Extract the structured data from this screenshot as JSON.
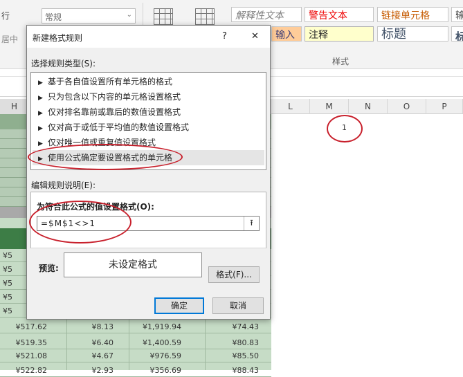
{
  "ribbon": {
    "left_label_1": "行",
    "left_label_2": "居中",
    "number_format": "常规",
    "styles": {
      "explanatory": "解释性文本",
      "warning": "警告文本",
      "linked_cell": "链接单元格",
      "input": "输入",
      "note": "注释",
      "title": "标题",
      "heading_partial_1": "输",
      "heading_partial_2": "标"
    },
    "group_label": "样式"
  },
  "sheet": {
    "columns": [
      "H",
      "L",
      "M",
      "N",
      "O",
      "P"
    ],
    "m1_value": "1",
    "rows": [
      [
        "¥5",
        "",
        "",
        ""
      ],
      [
        "¥5",
        "",
        "",
        ""
      ],
      [
        "¥5",
        "",
        "",
        ""
      ],
      [
        "¥5",
        "",
        "",
        ""
      ],
      [
        "¥5",
        "",
        "",
        ""
      ],
      [
        "¥517.62",
        "¥8.13",
        "¥1,919.94",
        "¥74.43"
      ],
      [
        "¥519.35",
        "¥6.40",
        "¥1,400.59",
        "¥80.83"
      ],
      [
        "¥521.08",
        "¥4.67",
        "¥976.59",
        "¥85.50"
      ],
      [
        "¥522.82",
        "¥2.93",
        "¥356.69",
        "¥88.43"
      ]
    ]
  },
  "dialog": {
    "title": "新建格式规则",
    "help": "?",
    "close": "✕",
    "select_type_label": "选择规则类型(S):",
    "rules": [
      "基于各自值设置所有单元格的格式",
      "只为包含以下内容的单元格设置格式",
      "仅对排名靠前或靠后的数值设置格式",
      "仅对高于或低于平均值的数值设置格式",
      "仅对唯一值或重复值设置格式",
      "使用公式确定要设置格式的单元格"
    ],
    "selected_rule_index": 5,
    "edit_desc_label": "编辑规则说明(E):",
    "formula_label": "为符合此公式的值设置格式(O):",
    "formula_value": "=$M$1<>1",
    "preview_label": "预览:",
    "preview_text": "未设定格式",
    "format_button": "格式(F)...",
    "ok": "确定",
    "cancel": "取消"
  },
  "colors": {
    "sheet_green": "#3d7d46",
    "sheet_light": "#c6dcc6",
    "annotation_red": "#c8202c",
    "accent_blue": "#0078d7"
  }
}
